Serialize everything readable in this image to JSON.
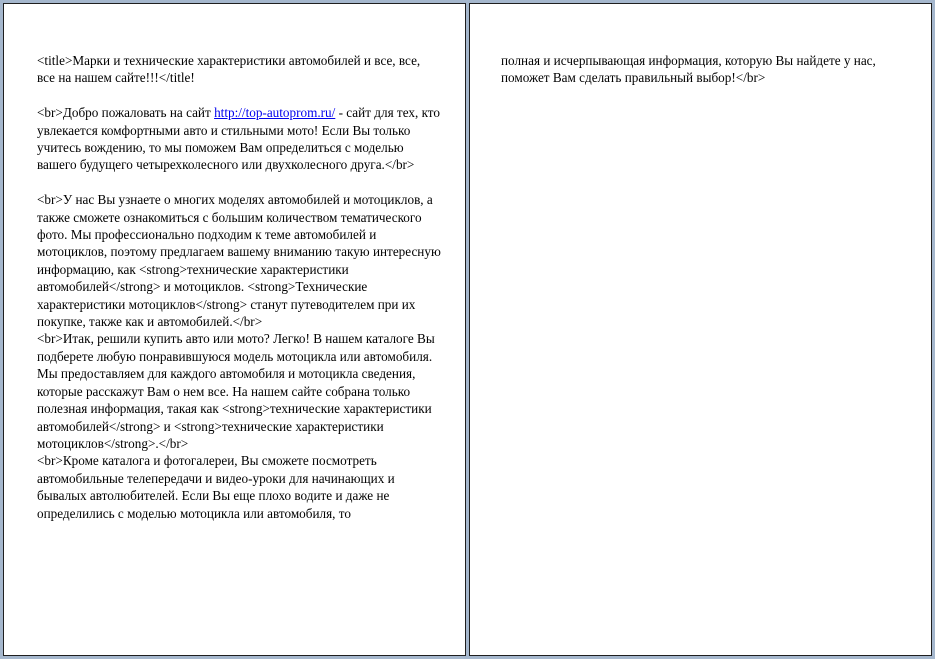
{
  "pages": {
    "left": {
      "blocks": [
        {
          "text": "<title>Марки и технические характеристики автомобилей и все, все, все на нашем сайте!!!</title!"
        },
        {
          "before": "<br>Добро пожаловать на сайт ",
          "link": "http://top-autoprom.ru/",
          "after": " - сайт для тех, кто увлекается комфортными авто и стильными мото! Если Вы только учитесь вождению, то мы поможем Вам определиться с моделью вашего будущего четырехколесного или двухколесного друга.</br>"
        },
        {
          "text": "<br>У нас Вы узнаете о многих моделях автомобилей и мотоциклов, а также сможете ознакомиться с большим количеством тематического фото. Мы профессионально подходим к теме автомобилей и мотоциклов, поэтому предлагаем вашему вниманию такую интересную информацию, как <strong>технические характеристики автомобилей</strong> и мотоциклов. <strong>Технические характеристики мотоциклов</strong> станут путеводителем при их покупке, также как и автомобилей.</br>"
        },
        {
          "text": "<br>Итак, решили купить авто или мото? Легко! В нашем каталоге Вы подберете любую понравившуюся модель мотоцикла или автомобиля. Мы предоставляем для каждого автомобиля и мотоцикла сведения, которые расскажут Вам о нем все. На нашем сайте собрана только полезная информация, такая как <strong>технические характеристики автомобилей</strong> и <strong>технические характеристики мотоциклов</strong>.</br>"
        },
        {
          "text": "<br>Кроме каталога и фотогалереи, Вы сможете посмотреть автомобильные телепередачи и видео-уроки для начинающих и бывалых автолюбителей. Если Вы еще плохо водите и даже не определились с моделью мотоцикла или автомобиля, то"
        }
      ]
    },
    "right": {
      "blocks": [
        {
          "text": "полная и исчерпывающая информация, которую Вы найдете у нас, поможет Вам сделать правильный выбор!</br>"
        }
      ]
    }
  },
  "colors": {
    "background": "#a5b7cd",
    "page": "#ffffff",
    "link": "#0000ee"
  }
}
